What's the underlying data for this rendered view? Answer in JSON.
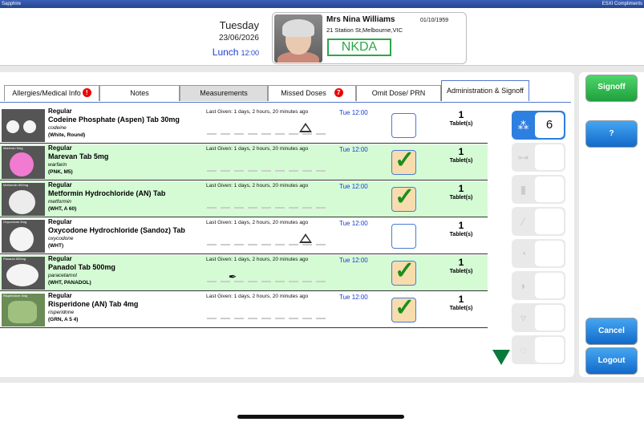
{
  "topbar": {
    "left": "Sapphire",
    "right": "ESXI Compliments"
  },
  "header": {
    "day": "Tuesday",
    "date": "23/06/2026",
    "meal": "Lunch",
    "meal_time": "12:00"
  },
  "patient": {
    "name": "Mrs Nina Williams",
    "dob": "01/10/1959",
    "address": "21 Station St,Melbourne,VIC",
    "allergy_status": "NKDA"
  },
  "tabs": [
    {
      "label": "Allergies/Medical Info",
      "badge": "!"
    },
    {
      "label": "Notes"
    },
    {
      "label": "Measurements"
    },
    {
      "label": "Missed Doses",
      "badge": "7"
    },
    {
      "label": "Omit Dose/ PRN"
    },
    {
      "label": "Administration & Signoff"
    }
  ],
  "medications": [
    {
      "pill_label": "",
      "freq": "Regular",
      "name": "Codeine Phosphate (Aspen) Tab 30mg",
      "generic": "codeine",
      "desc": "(White, Round)",
      "last_given": "Last Given: 1 days, 2 hours, 20 minutes ago",
      "due": "Tue 12:00",
      "qty": "1",
      "unit": "Tablet(s)",
      "signed": false,
      "icon": "triangle"
    },
    {
      "pill_label": "Marevan 5mg",
      "freq": "Regular",
      "name": "Marevan Tab 5mg",
      "generic": "warfarin",
      "desc": "(PNK, M5)",
      "last_given": "Last Given: 1 days, 2 hours, 20 minutes ago",
      "due": "Tue 12:00",
      "qty": "1",
      "unit": "Tablet(s)",
      "signed": true,
      "icon": ""
    },
    {
      "pill_label": "Metformin 500mg",
      "freq": "Regular",
      "name": "Metformin Hydrochloride (AN) Tab",
      "generic": "metformin",
      "desc": "(WHT, A 60)",
      "last_given": "Last Given: 1 days, 2 hours, 20 minutes ago",
      "due": "Tue 12:00",
      "qty": "1",
      "unit": "Tablet(s)",
      "signed": true,
      "icon": ""
    },
    {
      "pill_label": "Oxycodone 5mg",
      "freq": "Regular",
      "name": "Oxycodone Hydrochloride (Sandoz) Tab",
      "generic": "oxycodone",
      "desc": "(WHT)",
      "last_given": "Last Given: 1 days, 2 hours, 20 minutes ago",
      "due": "Tue 12:00",
      "qty": "1",
      "unit": "Tablet(s)",
      "signed": false,
      "icon": "triangle"
    },
    {
      "pill_label": "Panadol 500mg",
      "freq": "Regular",
      "name": "Panadol Tab 500mg",
      "generic": "paracetamol",
      "desc": "(WHT, PANADOL)",
      "last_given": "Last Given: 1 days, 2 hours, 20 minutes ago",
      "due": "Tue 12:00",
      "qty": "1",
      "unit": "Tablet(s)",
      "signed": true,
      "icon": "quill"
    },
    {
      "pill_label": "Risperidone 4mg",
      "freq": "Regular",
      "name": "Risperidone (AN) Tab 4mg",
      "generic": "risperidone",
      "desc": "(GRN, A 5 4)",
      "last_given": "Last Given: 1 days, 2 hours, 20 minutes ago",
      "due": "Tue 12:00",
      "qty": "1",
      "unit": "Tablet(s)",
      "signed": true,
      "icon": ""
    }
  ],
  "routes": [
    {
      "icon": "tablets-icon",
      "glyph": "⁂",
      "value": "6",
      "selected": true
    },
    {
      "icon": "capsule-icon",
      "glyph": "⊶",
      "value": "",
      "selected": false
    },
    {
      "icon": "liquid-icon",
      "glyph": "▮",
      "value": "",
      "selected": false
    },
    {
      "icon": "syringe-icon",
      "glyph": "⁄",
      "value": "",
      "selected": false
    },
    {
      "icon": "patch-icon",
      "glyph": "◔",
      "value": "",
      "selected": false
    },
    {
      "icon": "inhaler-icon",
      "glyph": "◗",
      "value": "",
      "selected": false
    },
    {
      "icon": "cup-icon",
      "glyph": "▿",
      "value": "",
      "selected": false
    },
    {
      "icon": "drops-icon",
      "glyph": "◌",
      "value": "",
      "selected": false
    }
  ],
  "side": {
    "signoff": "Signoff",
    "help": "?",
    "cancel": "Cancel",
    "logout": "Logout"
  },
  "colors": {
    "green_row": "#d5fbd5",
    "accent_blue": "#2d7fe0",
    "signoff_green": "#1ea03c"
  }
}
